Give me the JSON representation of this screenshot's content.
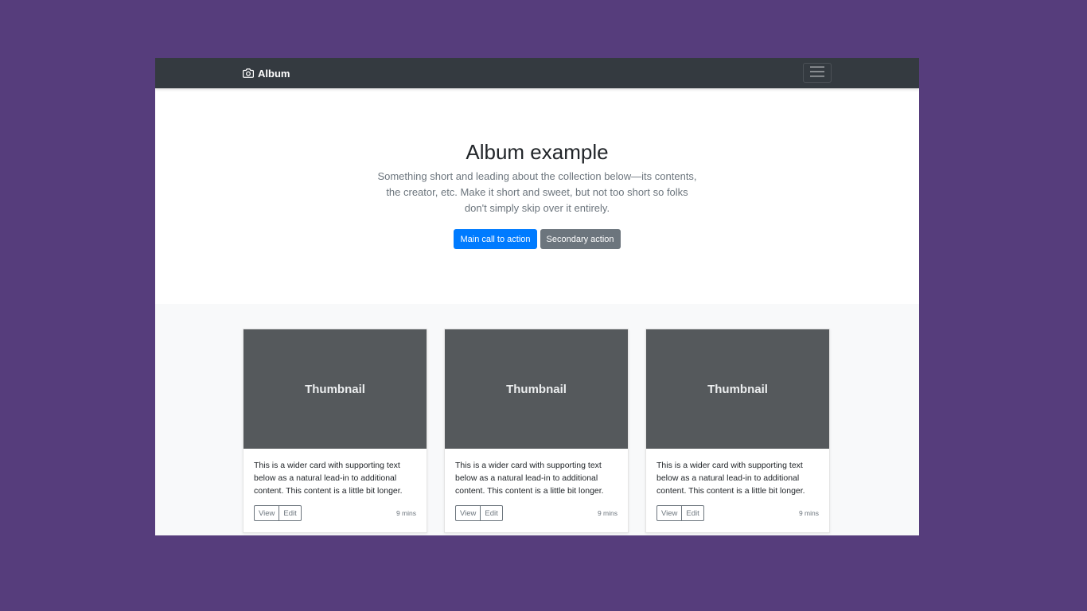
{
  "navbar": {
    "brand": "Album",
    "brand_icon": "camera-icon",
    "toggler_icon": "hamburger-menu-icon"
  },
  "hero": {
    "title": "Album example",
    "lead": "Something short and leading about the collection below—its contents, the creator, etc. Make it short and sweet, but not too short so folks don't simply skip over it entirely.",
    "primary_action": "Main call to action",
    "secondary_action": "Secondary action"
  },
  "cards": [
    {
      "thumbnail": "Thumbnail",
      "text": "This is a wider card with supporting text below as a natural lead-in to additional content. This content is a little bit longer.",
      "view": "View",
      "edit": "Edit",
      "time": "9 mins"
    },
    {
      "thumbnail": "Thumbnail",
      "text": "This is a wider card with supporting text below as a natural lead-in to additional content. This content is a little bit longer.",
      "view": "View",
      "edit": "Edit",
      "time": "9 mins"
    },
    {
      "thumbnail": "Thumbnail",
      "text": "This is a wider card with supporting text below as a natural lead-in to additional content. This content is a little bit longer.",
      "view": "View",
      "edit": "Edit",
      "time": "9 mins"
    }
  ],
  "colors": {
    "backdrop": "#563d7c",
    "navbar": "#343a40",
    "primary": "#007bff",
    "secondary": "#6c757d",
    "thumbnail": "#55595c",
    "album_bg": "#f8f9fa"
  }
}
